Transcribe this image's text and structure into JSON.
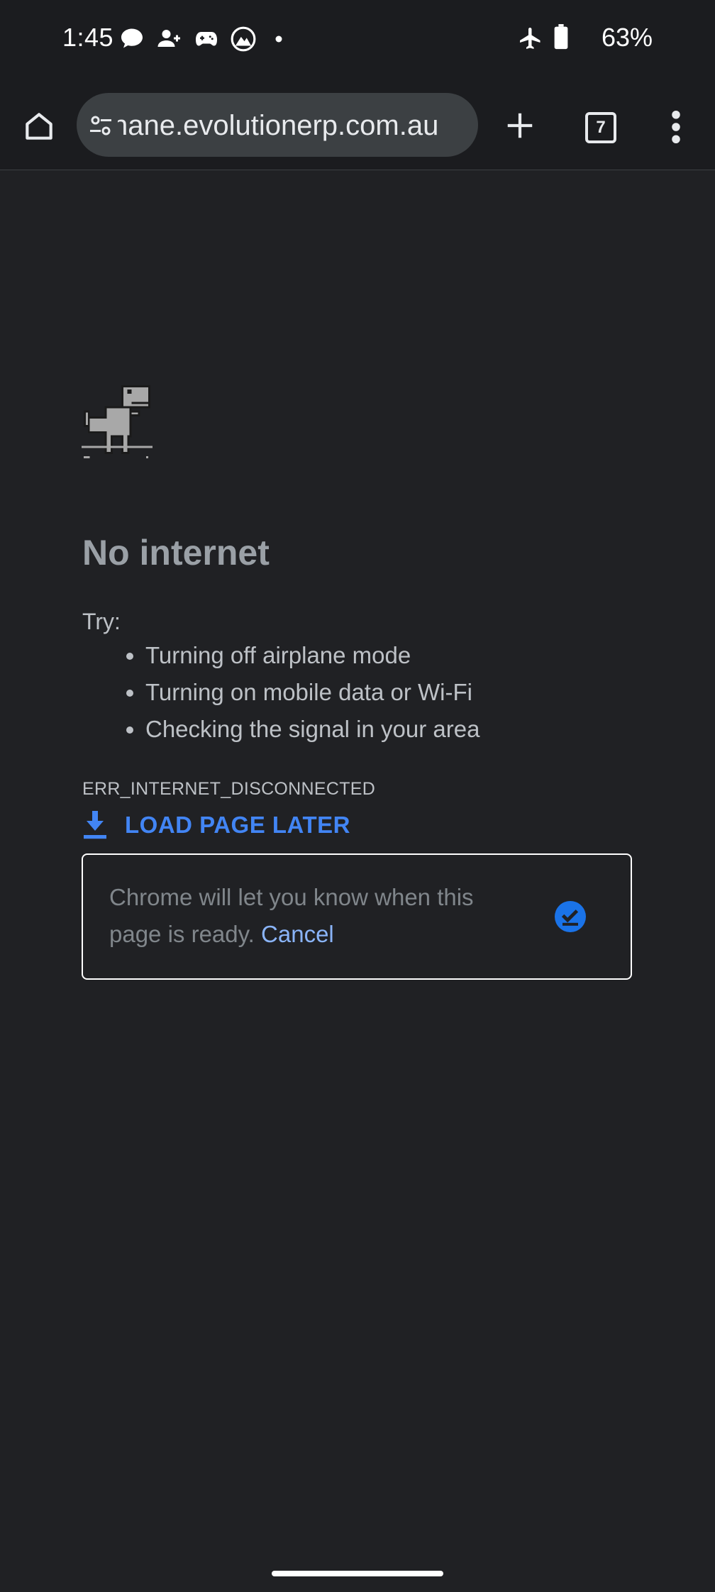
{
  "status_bar": {
    "time": "1:45",
    "notification_icons": [
      "chat-bubble-icon",
      "person-add-icon",
      "game-controller-icon",
      "mountain-app-icon",
      "dot-icon"
    ],
    "airplane_mode_icon": "airplane-icon",
    "battery_icon": "battery-icon",
    "battery_percent": "63%"
  },
  "toolbar": {
    "url": "nane.evolutionerp.com.au",
    "tab_count": "7",
    "icons": {
      "home": "home-icon",
      "site_settings": "tune-icon",
      "new_tab": "plus-icon",
      "menu": "more-vert-icon"
    }
  },
  "error_page": {
    "heading": "No internet",
    "try_label": "Try:",
    "suggestions": [
      "Turning off airplane mode",
      "Turning on mobile data or Wi-Fi",
      "Checking the signal in your area"
    ],
    "error_code": "ERR_INTERNET_DISCONNECTED",
    "load_later_label": "LOAD PAGE LATER",
    "notice_text": "Chrome will let you know when this page is ready.",
    "notice_cancel": "Cancel"
  },
  "colors": {
    "background": "#202124",
    "toolbar": "#1b1c1f",
    "accent_blue": "#4285f4",
    "link_blue": "#8ab4f8",
    "check_blue": "#1a73e8"
  }
}
